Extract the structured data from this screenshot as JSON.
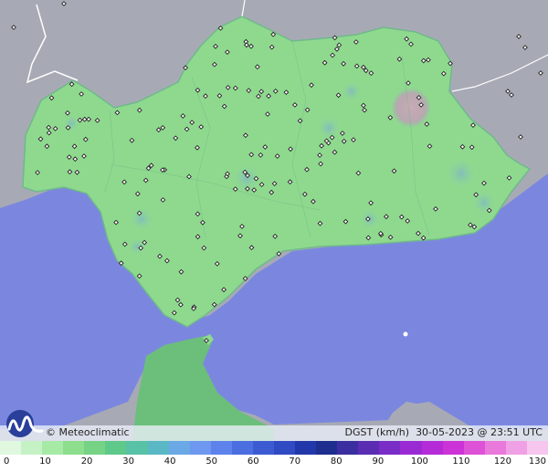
{
  "map": {
    "copyright": "© Meteoclimatic",
    "variable": "DGST (km/h)",
    "timestamp": "30-05-2023 @ 23:51 UTC",
    "colors": {
      "sea": "#7b87df",
      "land_outside": "#a7aab4",
      "region_fill": "#8fd98f",
      "africa_fill": "#6cbf7a"
    }
  },
  "legend": {
    "ticks": [
      "0",
      "10",
      "20",
      "30",
      "40",
      "50",
      "60",
      "70",
      "80",
      "90",
      "100",
      "110",
      "120",
      "130"
    ],
    "colors": [
      "#dff8df",
      "#c4f2c4",
      "#a6eaa6",
      "#8ddf8d",
      "#76d386",
      "#5fc98a",
      "#58c2a6",
      "#59b8c4",
      "#6aa9e6",
      "#6e98f0",
      "#5d82ec",
      "#4b6ee0",
      "#3c5bd3",
      "#2f4ac2",
      "#2238aa",
      "#1d2e8f",
      "#3b2ea0",
      "#5a2db2",
      "#7a2cc6",
      "#9a2bd4",
      "#b52bd8",
      "#cc33d6",
      "#de52d8",
      "#e979db",
      "#f0a0e4",
      "#f6c6ee"
    ]
  },
  "stations": {
    "count_shown": 180
  }
}
